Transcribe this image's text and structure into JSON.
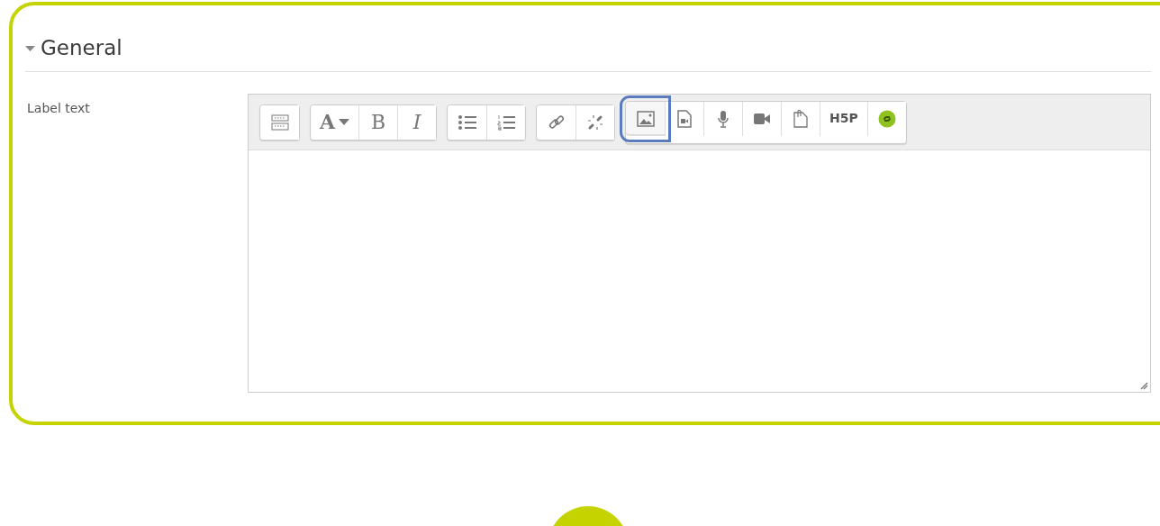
{
  "section": {
    "title": "General",
    "expanded": true
  },
  "field": {
    "label": "Label text"
  },
  "toolbar": {
    "groups": [
      {
        "buttons": [
          {
            "kind": "collapse",
            "highlighted": false
          }
        ]
      },
      {
        "buttons": [
          {
            "kind": "font",
            "text": "A",
            "highlighted": false
          },
          {
            "kind": "bold",
            "text": "B",
            "highlighted": false
          },
          {
            "kind": "italic",
            "text": "I",
            "highlighted": false
          }
        ]
      },
      {
        "buttons": [
          {
            "kind": "bullets",
            "highlighted": false
          },
          {
            "kind": "numbers",
            "highlighted": false
          }
        ]
      },
      {
        "buttons": [
          {
            "kind": "link",
            "highlighted": false
          },
          {
            "kind": "unlink",
            "highlighted": false
          }
        ]
      },
      {
        "buttons": [
          {
            "kind": "image",
            "highlighted": true
          },
          {
            "kind": "media",
            "highlighted": false
          },
          {
            "kind": "audio",
            "highlighted": false
          },
          {
            "kind": "video",
            "highlighted": false
          },
          {
            "kind": "file",
            "highlighted": false
          },
          {
            "kind": "h5p",
            "text": "H5P",
            "highlighted": false
          },
          {
            "kind": "plugin",
            "highlighted": false
          }
        ]
      }
    ]
  }
}
